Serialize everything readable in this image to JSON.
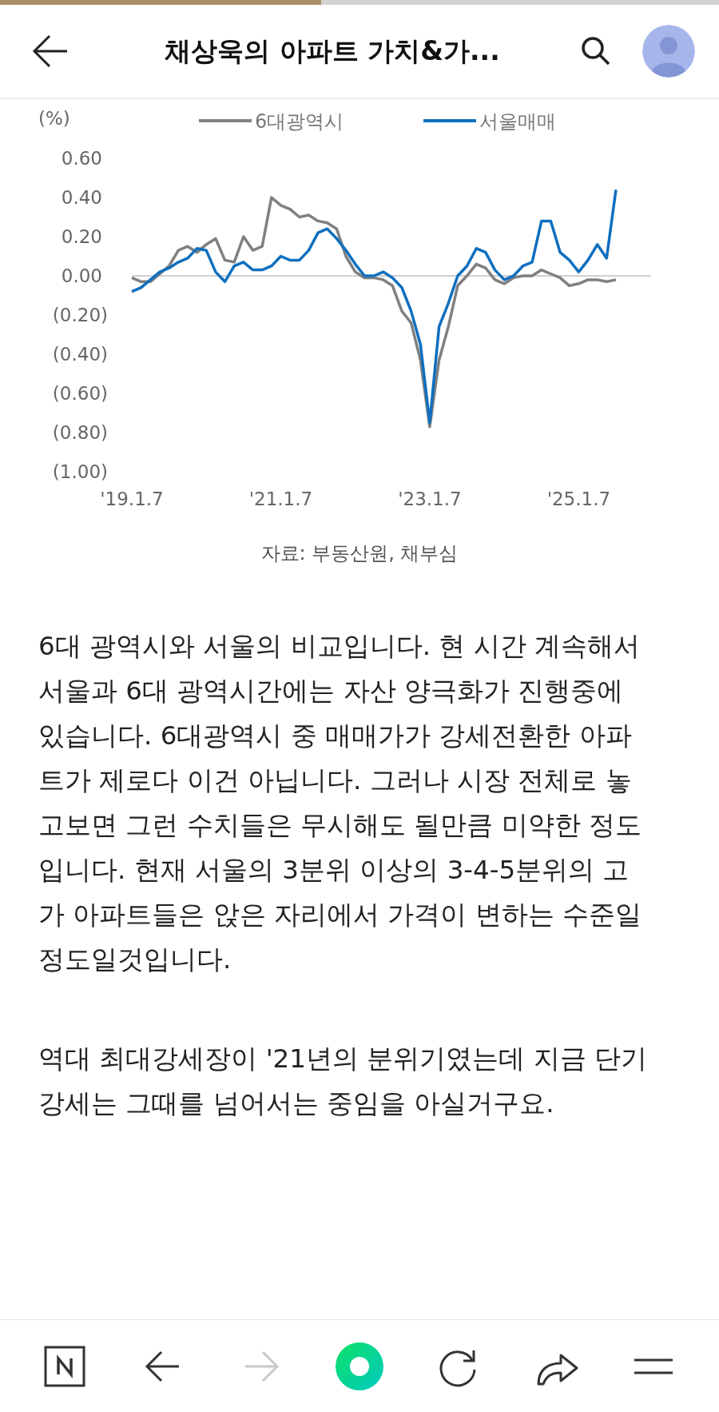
{
  "reading_progress": {
    "level": 0.447
  },
  "header": {
    "title": "채상욱의 아파트 가치&가..."
  },
  "chart": {
    "source": "자료: 부동산원, 채부심",
    "chart_data": {
      "type": "line",
      "ylabel": "(%)",
      "ylim": [
        -1.0,
        0.6
      ],
      "legend": "top",
      "yticks": [
        {
          "value": 0.6,
          "label": "0.60"
        },
        {
          "value": 0.4,
          "label": "0.40"
        },
        {
          "value": 0.2,
          "label": "0.20"
        },
        {
          "value": 0.0,
          "label": "0.00"
        },
        {
          "value": -0.2,
          "label": "(0.20)"
        },
        {
          "value": -0.4,
          "label": "(0.40)"
        },
        {
          "value": -0.6,
          "label": "(0.60)"
        },
        {
          "value": -0.8,
          "label": "(0.80)"
        },
        {
          "value": -1.0,
          "label": "(1.00)"
        }
      ],
      "categories": [
        "'19.1.7",
        null,
        null,
        null,
        null,
        null,
        null,
        null,
        null,
        null,
        null,
        null,
        null,
        null,
        null,
        null,
        "'21.1.7",
        null,
        null,
        null,
        null,
        null,
        null,
        null,
        null,
        null,
        null,
        null,
        null,
        null,
        null,
        null,
        "'23.1.7",
        null,
        null,
        null,
        null,
        null,
        null,
        null,
        null,
        null,
        null,
        null,
        null,
        null,
        null,
        null,
        "'25.1.7",
        null,
        null,
        null,
        null
      ],
      "series": [
        {
          "name": "6대광역시",
          "color": "#808080",
          "values": [
            -0.01,
            -0.03,
            -0.03,
            0.01,
            0.05,
            0.13,
            0.15,
            0.12,
            0.16,
            0.19,
            0.08,
            0.07,
            0.2,
            0.13,
            0.15,
            0.4,
            0.36,
            0.34,
            0.3,
            0.31,
            0.28,
            0.27,
            0.24,
            0.1,
            0.02,
            -0.01,
            -0.01,
            -0.02,
            -0.05,
            -0.18,
            -0.24,
            -0.43,
            -0.77,
            -0.43,
            -0.26,
            -0.05,
            0.0,
            0.06,
            0.04,
            -0.02,
            -0.04,
            -0.01,
            0.0,
            0.0,
            0.03,
            0.01,
            -0.01,
            -0.05,
            -0.04,
            -0.02,
            -0.02,
            -0.03,
            -0.02
          ]
        },
        {
          "name": "서울매매",
          "color": "#0f6fbf",
          "values": [
            -0.08,
            -0.06,
            -0.02,
            0.02,
            0.04,
            0.07,
            0.09,
            0.14,
            0.13,
            0.02,
            -0.03,
            0.05,
            0.07,
            0.03,
            0.03,
            0.05,
            0.1,
            0.08,
            0.08,
            0.13,
            0.22,
            0.24,
            0.19,
            0.13,
            0.06,
            0.0,
            0.0,
            0.02,
            -0.01,
            -0.06,
            -0.18,
            -0.35,
            -0.75,
            -0.26,
            -0.14,
            0.0,
            0.05,
            0.14,
            0.12,
            0.03,
            -0.02,
            0.0,
            0.05,
            0.07,
            0.28,
            0.28,
            0.12,
            0.08,
            0.02,
            0.08,
            0.16,
            0.09,
            0.44
          ]
        }
      ]
    }
  },
  "paragraphs": [
    "6대 광역시와 서울의 비교입니다. 현 시간 계속해서 서울과 6대 광역시간에는 자산 양극화가 진행중에 있습니다. 6대광역시 중 매매가가 강세전환한 아파트가 제로다 이건 아닙니다. 그러나 시장 전체로 놓고보면 그런 수치들은 무시해도 될만큼 미약한 정도입니다. 현재 서울의 3분위 이상의 3-4-5분위의 고가 아파트들은 앉은 자리에서 가격이 변하는 수준일 정도일것입니다.",
    "역대 최대강세장이 '21년의 분위기였는데 지금 단기 강세는 그때를 넘어서는 중임을 아실거구요."
  ],
  "bottom_bar": {
    "items": [
      {
        "kind": "home",
        "disabled": false
      },
      {
        "kind": "back",
        "disabled": false
      },
      {
        "kind": "forward",
        "disabled": true
      },
      {
        "kind": "green",
        "disabled": false
      },
      {
        "kind": "reload",
        "disabled": false
      },
      {
        "kind": "share",
        "disabled": false
      },
      {
        "kind": "menu",
        "disabled": false
      }
    ]
  }
}
